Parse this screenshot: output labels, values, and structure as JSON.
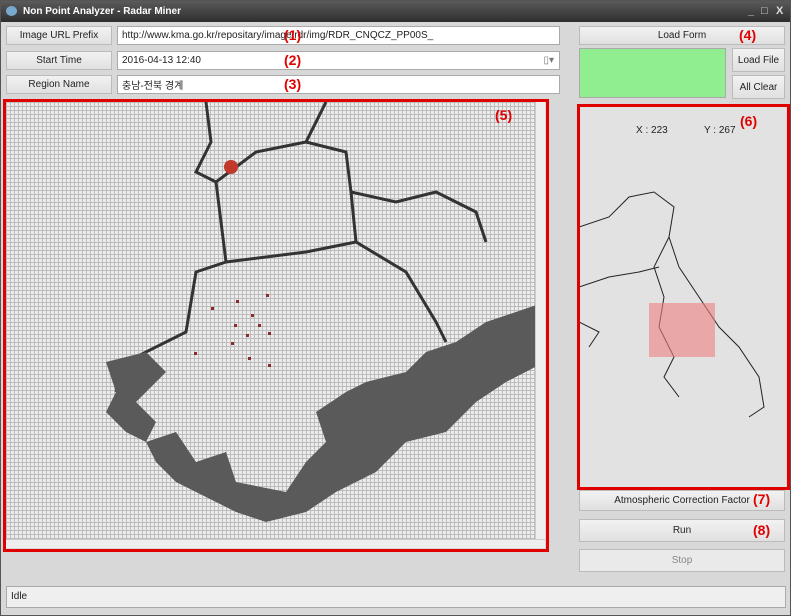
{
  "window": {
    "title": "Non Point Analyzer - Radar Miner",
    "controls": [
      "_",
      "□",
      "X"
    ]
  },
  "form": {
    "url_label": "Image URL Prefix",
    "url_value": "http://www.kma.go.kr/repositary/image/rdr/img/RDR_CNQCZ_PP00S_",
    "start_label": "Start Time",
    "start_value": "2016-04-13 12:40",
    "region_label": "Region Name",
    "region_value": "충남-전북 경계"
  },
  "right": {
    "load_form": "Load Form",
    "load_file": "Load File",
    "all_clear": "All Clear",
    "swatch_color": "#90ee90",
    "coord_x": "X : 223",
    "coord_y": "Y : 267",
    "atmospheric": "Atmospheric Correction Factor",
    "run": "Run",
    "stop": "Stop"
  },
  "annotations": [
    "(1)",
    "(2)",
    "(3)",
    "(4)",
    "(5)",
    "(6)",
    "(7)",
    "(8)"
  ],
  "status": "Idle",
  "colors": {
    "annotation": "#e00000",
    "selection": "#f08080"
  }
}
